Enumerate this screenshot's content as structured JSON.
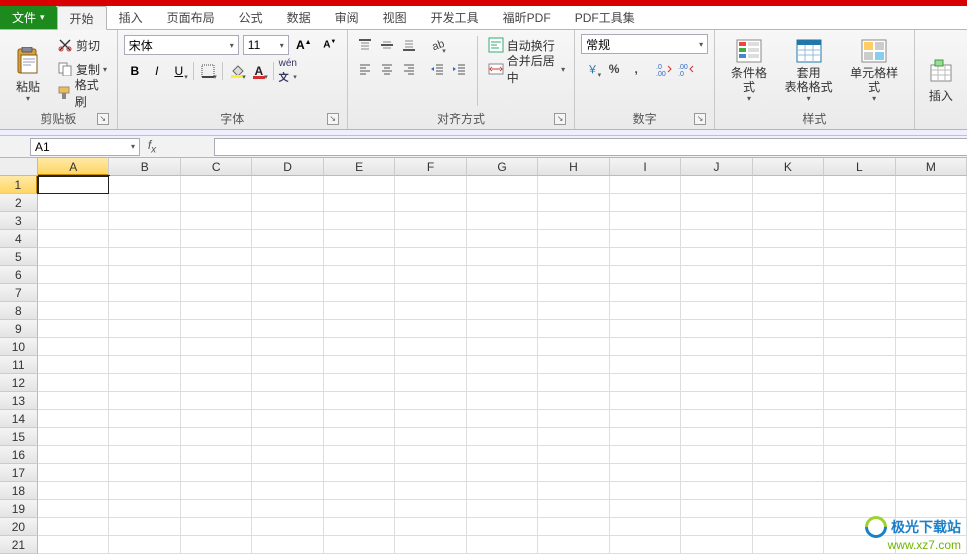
{
  "tabs": {
    "file": "文件",
    "items": [
      "开始",
      "插入",
      "页面布局",
      "公式",
      "数据",
      "审阅",
      "视图",
      "开发工具",
      "福昕PDF",
      "PDF工具集"
    ],
    "activeIndex": 0
  },
  "ribbon": {
    "clipboard": {
      "label": "剪贴板",
      "paste": "粘贴",
      "cut": "剪切",
      "copy": "复制",
      "format_painter": "格式刷"
    },
    "font": {
      "label": "字体",
      "name": "宋体",
      "size": "11",
      "bold": "B",
      "italic": "I",
      "underline": "U"
    },
    "alignment": {
      "label": "对齐方式",
      "wrap": "自动换行",
      "merge": "合并后居中"
    },
    "number": {
      "label": "数字",
      "format": "常规"
    },
    "styles": {
      "label": "样式",
      "cond": "条件格式",
      "table": "套用\n表格格式",
      "cell": "单元格样式"
    },
    "insert_partial": "插入"
  },
  "namebox": "A1",
  "columns": [
    "A",
    "B",
    "C",
    "D",
    "E",
    "F",
    "G",
    "H",
    "I",
    "J",
    "K",
    "L",
    "M"
  ],
  "rowcount": 21,
  "activeCell": {
    "row": 1,
    "col": 0
  },
  "watermark": {
    "title": "极光下载站",
    "url": "www.xz7.com"
  }
}
